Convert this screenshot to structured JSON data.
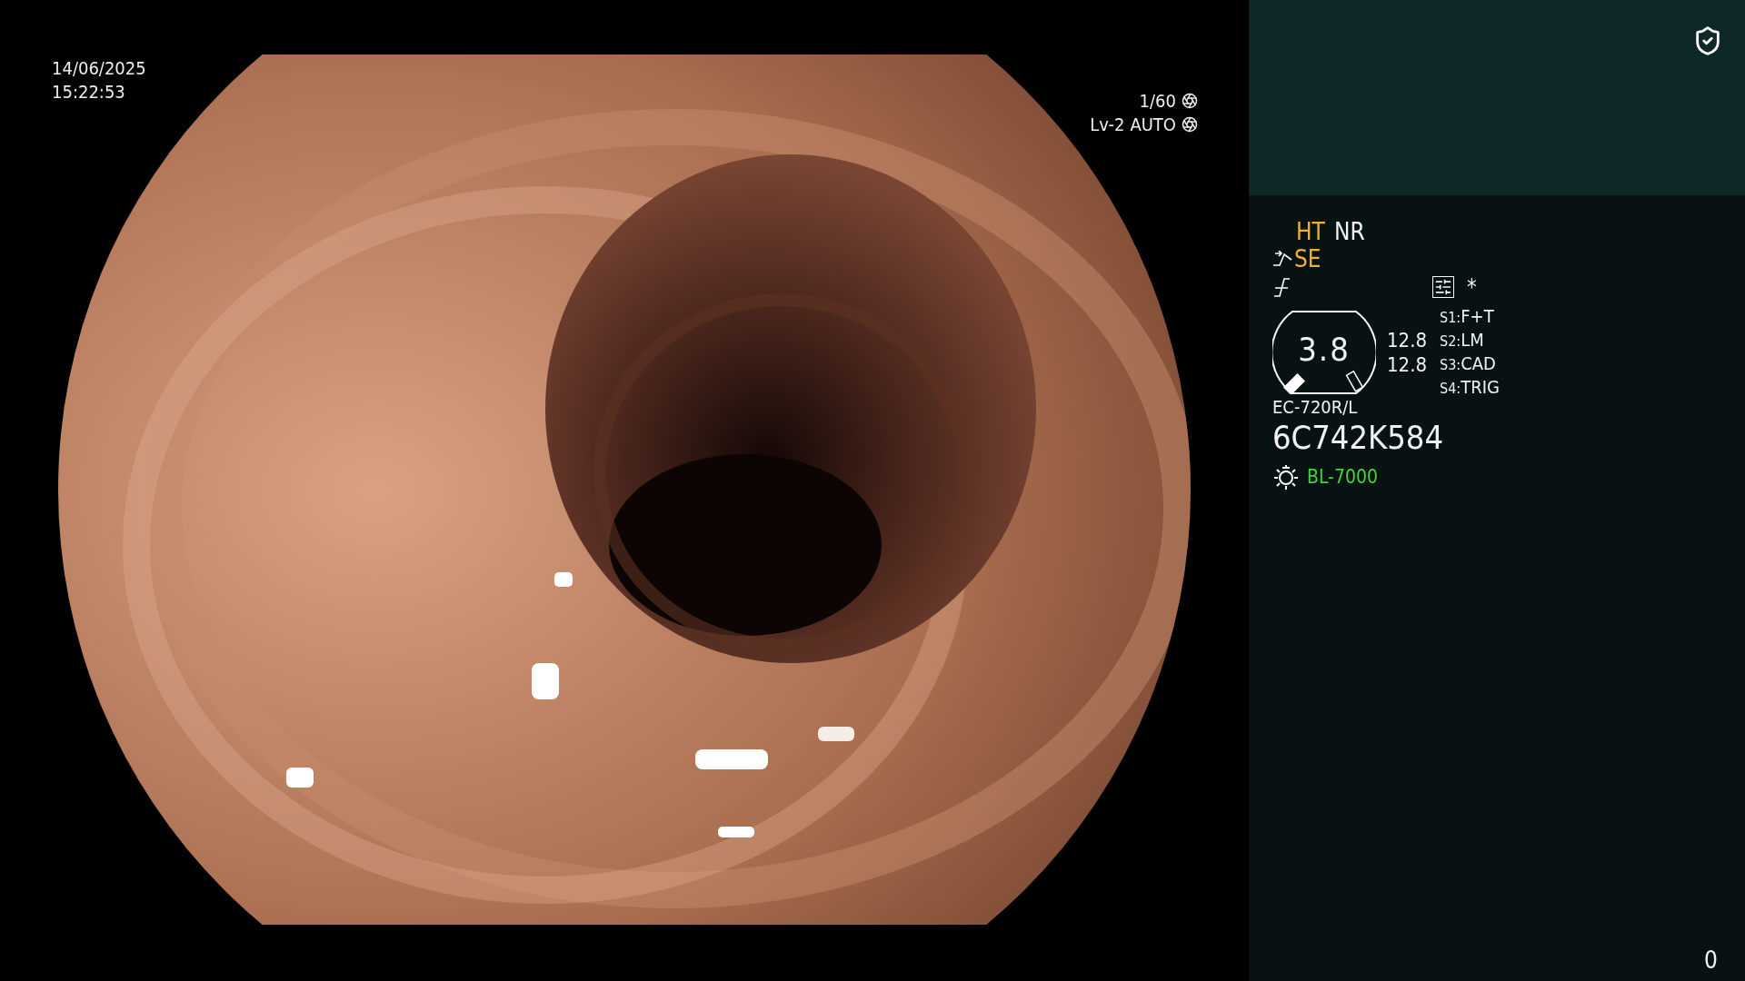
{
  "timestamp": {
    "date": "14/06/2025",
    "time": "15:22:53"
  },
  "exposure": {
    "shutter": "1/60",
    "level": "Lv-2",
    "mode": "AUTO"
  },
  "modes": [
    {
      "label": "HT",
      "highlighted": true
    },
    {
      "label": "NR",
      "highlighted": false
    }
  ],
  "enhancement": {
    "label": "SE",
    "highlighted": true
  },
  "marker": "*",
  "gauge": {
    "value": "3.8",
    "readings": [
      "12.8",
      "12.8"
    ]
  },
  "switches": [
    {
      "key": "S1:",
      "value": "F+T"
    },
    {
      "key": "S2:",
      "value": "LM"
    },
    {
      "key": "S3:",
      "value": "CAD"
    },
    {
      "key": "S4:",
      "value": "TRIG"
    }
  ],
  "scope": {
    "model": "EC-720R/L",
    "serial": "6C742K584"
  },
  "light": {
    "label": "BL-7000"
  },
  "counter": "0"
}
